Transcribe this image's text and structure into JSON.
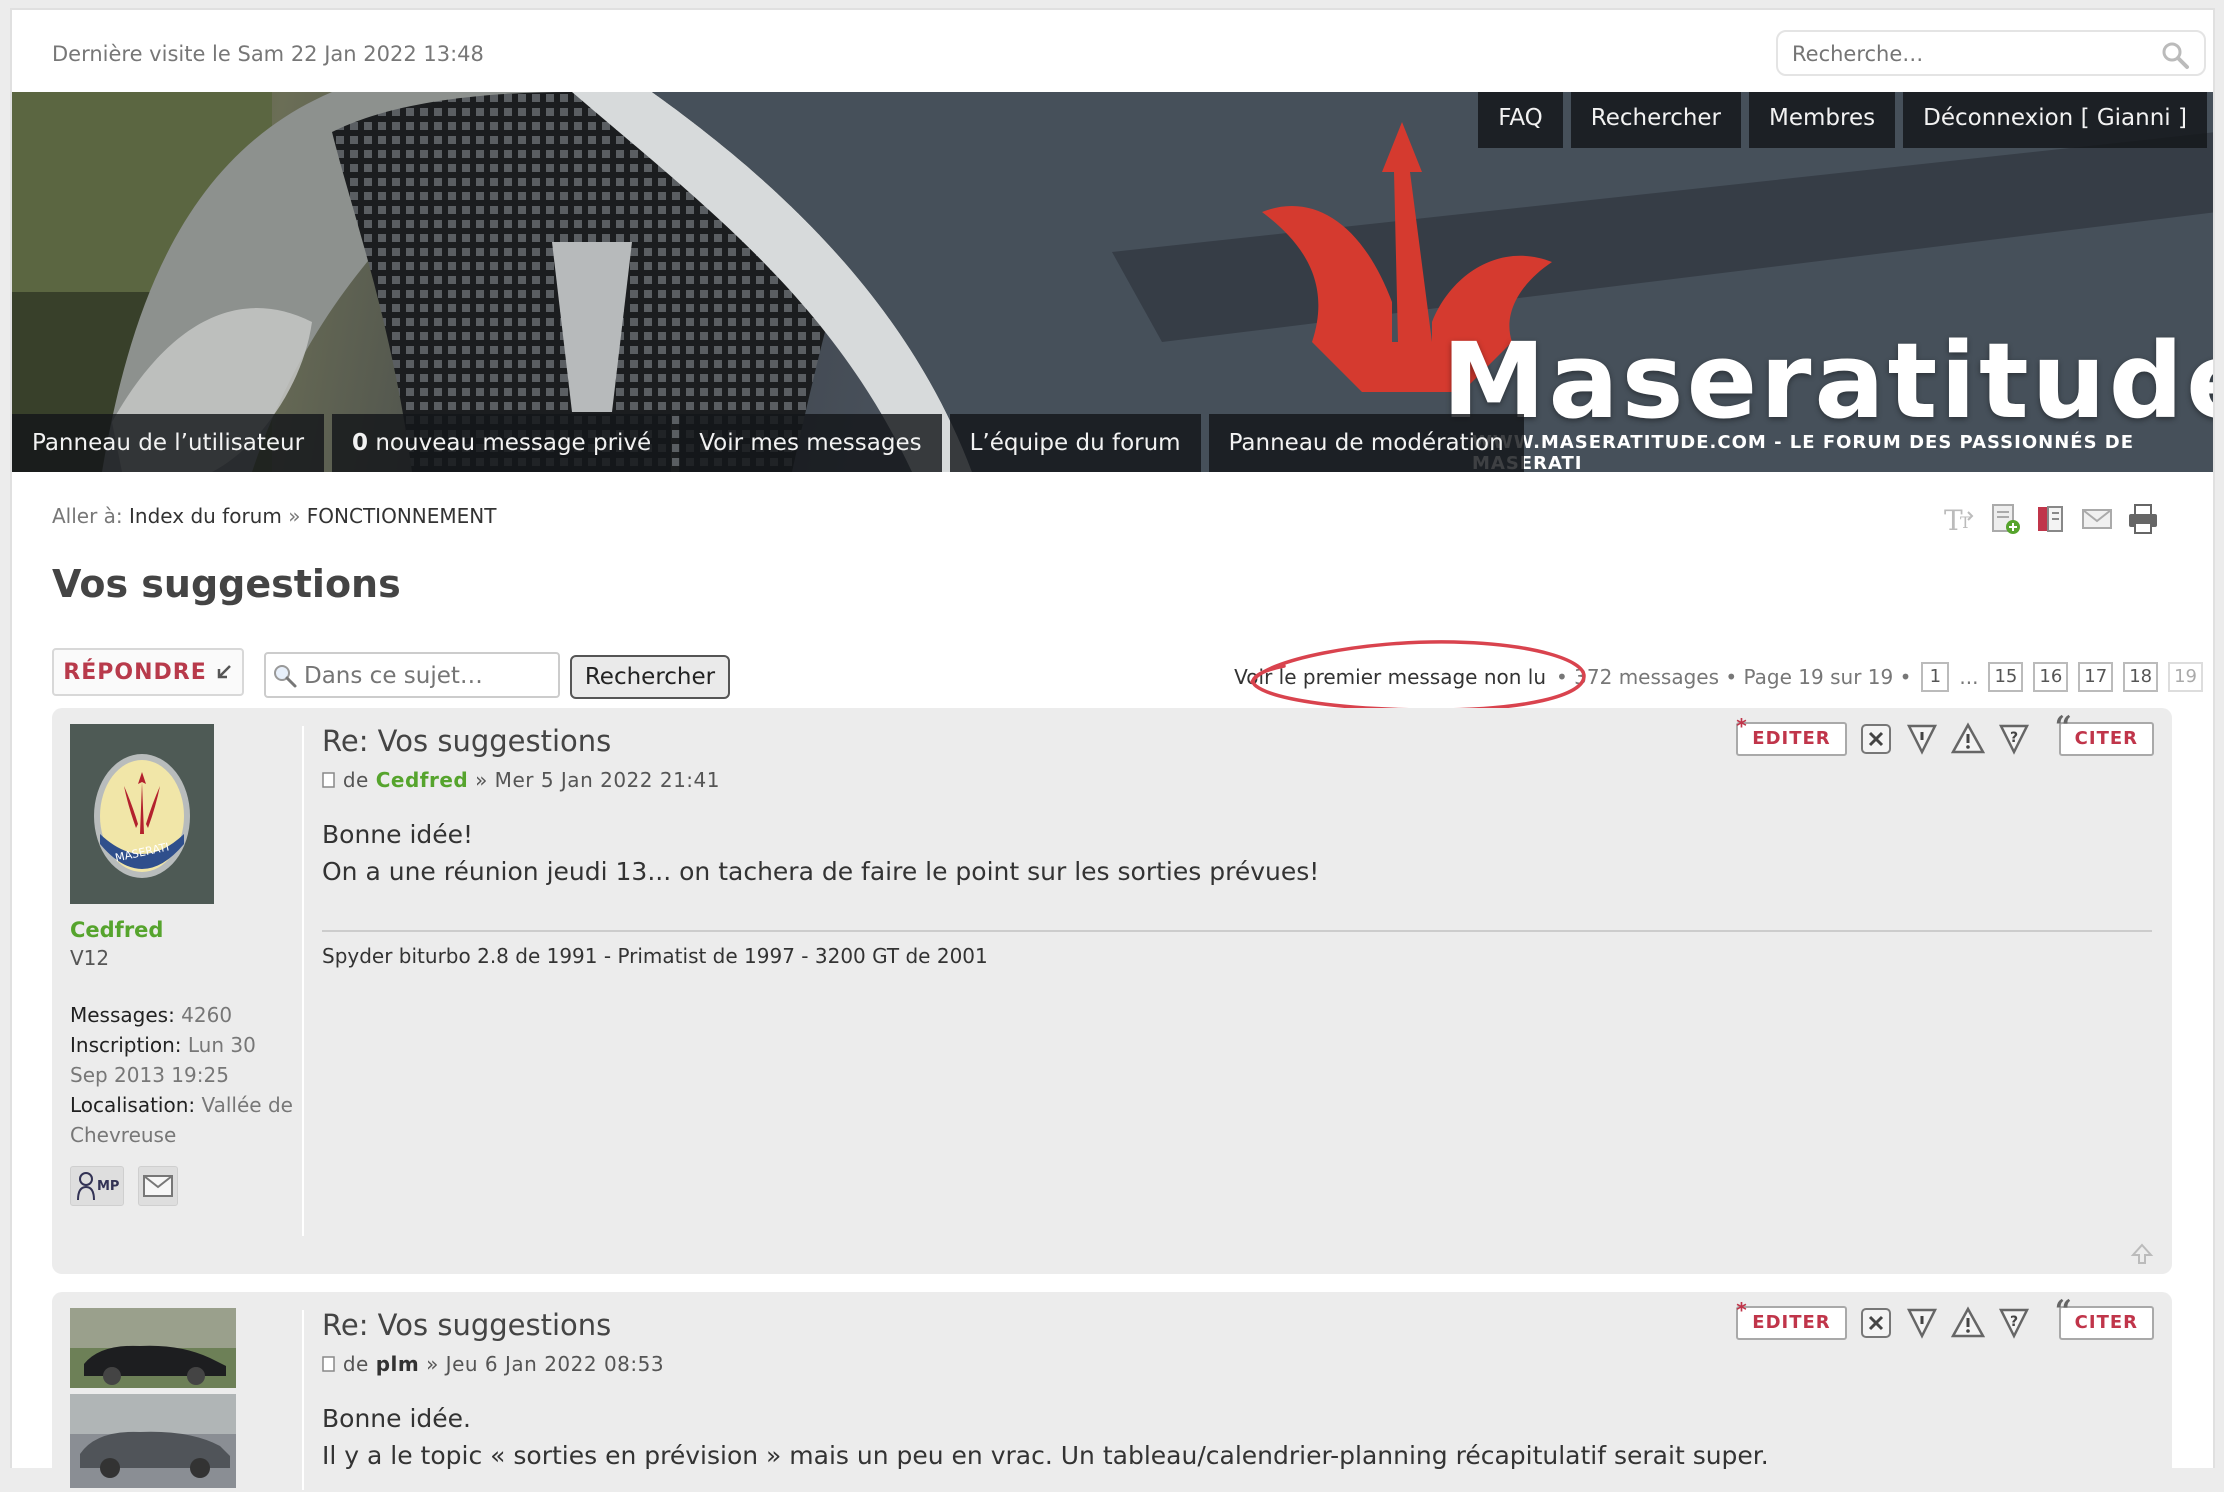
{
  "header": {
    "last_visit": "Dernière visite le Sam 22 Jan 2022 13:48",
    "search_placeholder": "Recherche…"
  },
  "top_nav": {
    "faq": "FAQ",
    "search": "Rechercher",
    "members": "Membres",
    "logout": "Déconnexion [ Gianni ]"
  },
  "bottom_nav": {
    "user_panel": "Panneau de l’utilisateur",
    "pm_count": "0",
    "pm_label": " nouveau message privé",
    "my_posts": "Voir mes messages",
    "team": "L’équipe du forum",
    "moderation": "Panneau de modération"
  },
  "brand": {
    "name": "Maseratitude",
    "tagline": "WWW.MASERATITUDE.COM  - LE FORUM DES PASSIONNÉS DE MASERATI"
  },
  "breadcrumb": {
    "prefix": "Aller à: ",
    "index": "Index du forum",
    "sep": " » ",
    "section": "FONCTIONNEMENT"
  },
  "topic": {
    "title": "Vos suggestions",
    "reply_label": "RÉPONDRE",
    "search_placeholder": "Dans ce sujet…",
    "search_button": "Rechercher"
  },
  "pagination": {
    "first_unread": "Voir le premier message non lu",
    "summary": "• 372 messages • Page 19 sur 19 •",
    "ellipsis": "...",
    "pages": [
      "1",
      "15",
      "16",
      "17",
      "18",
      "19"
    ]
  },
  "post_actions": {
    "edit": "EDITER",
    "quote": "CITER"
  },
  "posts": [
    {
      "title": "Re: Vos suggestions",
      "by": "de ",
      "author": "Cedfred",
      "date": " » Mer 5 Jan 2022 21:41",
      "rank": "V12",
      "messages_label": "Messages:",
      "messages": " 4260",
      "joined_label": "Inscription:",
      "joined": " Lun 30 Sep 2013 19:25",
      "location_label": "Localisation:",
      "location": " Vallée de Chevreuse",
      "content_line1": "Bonne idée!",
      "content_line2": "On a une réunion jeudi 13... on tachera de faire le point sur les sorties prévues!",
      "signature": "Spyder biturbo 2.8 de 1991 - Primatist de 1997 - 3200 GT de 2001",
      "pm_label": "MP"
    },
    {
      "title": "Re: Vos suggestions",
      "by": "de ",
      "author": "plm",
      "date": " » Jeu 6 Jan 2022 08:53",
      "content_line1": "Bonne idée.",
      "content_line2": "Il y a le topic « sorties en prévision » mais un peu en vrac. Un tableau/calendrier-planning récapitulatif serait super."
    }
  ],
  "colors": {
    "accent_red": "#c0354a",
    "author_green": "#56a42d",
    "annotation_red": "#d9434e"
  }
}
